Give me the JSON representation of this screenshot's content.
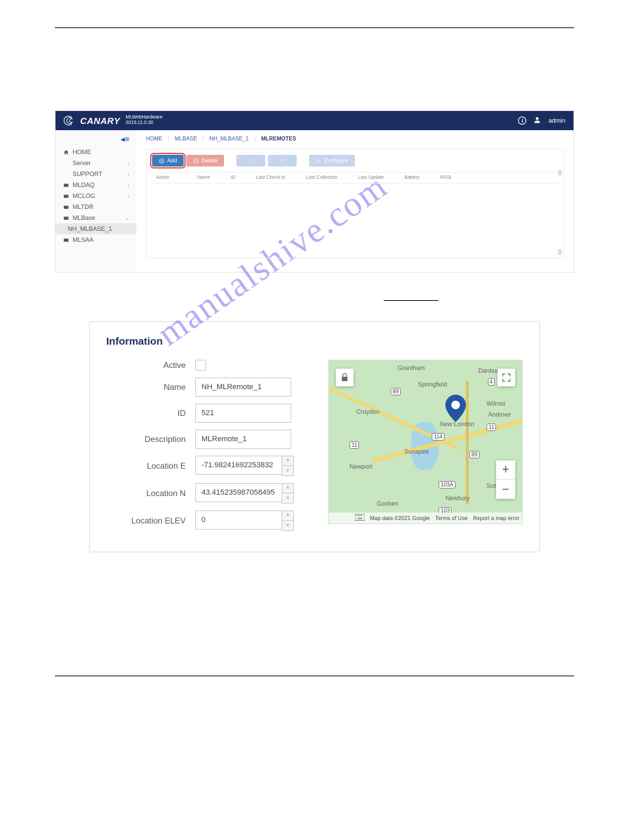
{
  "watermark": "manualshive.com",
  "screenshot1": {
    "header": {
      "logo": "CANARY",
      "product": "MLWebHardware",
      "version": "2019.11.0.30",
      "user_label": "admin"
    },
    "sidebar": {
      "items": [
        {
          "label": "HOME",
          "icon": "home"
        },
        {
          "label": "Server",
          "chev": true
        },
        {
          "label": "SUPPORT",
          "chev": true
        },
        {
          "label": "MLDAQ",
          "icon": "device",
          "chev": true
        },
        {
          "label": "MCLOG",
          "icon": "device",
          "chev": true
        },
        {
          "label": "MLTDR",
          "icon": "device"
        },
        {
          "label": "MLBase",
          "icon": "device",
          "chev_down": true
        },
        {
          "label": "NH_MLBASE_1",
          "sub": true
        },
        {
          "label": "MLSAA",
          "icon": "device"
        }
      ]
    },
    "breadcrumb": [
      "HOME",
      "MLBASE",
      "NH_MLBASE_1",
      "MLREMOTES"
    ],
    "toolbar": {
      "add": "Add",
      "delete": "Delete",
      "configure": "Configure"
    },
    "table_headers": [
      "Active",
      "Name",
      "ID",
      "Last Check In",
      "Last Collection",
      "Last Update",
      "Battery",
      "RSSI"
    ]
  },
  "info_panel": {
    "title": "Information",
    "fields": {
      "active": "Active",
      "name": {
        "label": "Name",
        "value": "NH_MLRemote_1"
      },
      "id": {
        "label": "ID",
        "value": "521"
      },
      "description": {
        "label": "Description",
        "value": "MLRemote_1"
      },
      "loc_e": {
        "label": "Location E",
        "value": "-71.98241692253832"
      },
      "loc_n": {
        "label": "Location N",
        "value": "43.415235987058495"
      },
      "loc_elev": {
        "label": "Location ELEV",
        "value": "0"
      }
    },
    "map": {
      "labels": {
        "grantham": "Grantham",
        "danbury": "Danbury",
        "springfield": "Springfield",
        "croydon": "Croydon",
        "wilmot": "Wilmot",
        "andover": "Andover",
        "newlondon": "New London",
        "sunapee": "Sunapee",
        "newport": "Newport",
        "sutton": "Sutton",
        "newbury": "Newbury",
        "goshen": "Goshen"
      },
      "shields": {
        "s89": "89",
        "s4": "4",
        "s11a": "11",
        "s114": "114",
        "s11b": "11",
        "s103a": "103A",
        "s103": "103",
        "s89b": "89"
      },
      "footer": {
        "data": "Map data ©2021 Google",
        "terms": "Terms of Use",
        "report": "Report a map error"
      }
    }
  }
}
